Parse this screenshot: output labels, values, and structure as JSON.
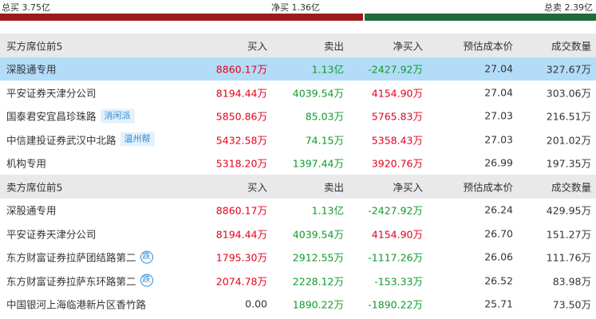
{
  "summary": {
    "buy_total": "总买 3.75亿",
    "net_buy": "净买 1.36亿",
    "sell_total": "总卖 2.39亿"
  },
  "buy_section": {
    "header": [
      "买方席位前5",
      "买入",
      "卖出",
      "净买入",
      "预估成本价",
      "成交数量"
    ],
    "rows": [
      {
        "name": "深股通专用",
        "tag": "",
        "icon": "",
        "buy": "8860.17万",
        "sell": "1.13亿",
        "net": "-2427.92万",
        "cost": "27.04",
        "vol": "327.67万",
        "buy_color": "red",
        "sell_color": "green",
        "net_color": "green"
      },
      {
        "name": "平安证券天津分公司",
        "tag": "",
        "icon": "",
        "buy": "8194.44万",
        "sell": "4039.54万",
        "net": "4154.90万",
        "cost": "27.04",
        "vol": "303.06万",
        "buy_color": "red",
        "sell_color": "green",
        "net_color": "red"
      },
      {
        "name": "国泰君安宜昌珍珠路",
        "tag": "消闲派",
        "icon": "",
        "buy": "5850.86万",
        "sell": "85.03万",
        "net": "5765.83万",
        "cost": "27.03",
        "vol": "216.51万",
        "buy_color": "red",
        "sell_color": "green",
        "net_color": "red"
      },
      {
        "name": "中信建投证券武汉中北路",
        "tag": "温州帮",
        "icon": "",
        "buy": "5432.58万",
        "sell": "74.15万",
        "net": "5358.43万",
        "cost": "27.03",
        "vol": "201.02万",
        "buy_color": "red",
        "sell_color": "green",
        "net_color": "red"
      },
      {
        "name": "机构专用",
        "tag": "",
        "icon": "",
        "buy": "5318.20万",
        "sell": "1397.44万",
        "net": "3920.76万",
        "cost": "26.99",
        "vol": "197.35万",
        "buy_color": "red",
        "sell_color": "green",
        "net_color": "red"
      }
    ]
  },
  "sell_section": {
    "header": [
      "卖方席位前5",
      "买入",
      "卖出",
      "净买入",
      "预估成本价",
      "成交数量"
    ],
    "rows": [
      {
        "name": "深股通专用",
        "tag": "",
        "icon": "",
        "buy": "8860.17万",
        "sell": "1.13亿",
        "net": "-2427.92万",
        "cost": "26.24",
        "vol": "429.95万",
        "buy_color": "red",
        "sell_color": "green",
        "net_color": "green"
      },
      {
        "name": "平安证券天津分公司",
        "tag": "",
        "icon": "",
        "buy": "8194.44万",
        "sell": "4039.54万",
        "net": "4154.90万",
        "cost": "26.70",
        "vol": "151.27万",
        "buy_color": "red",
        "sell_color": "green",
        "net_color": "red"
      },
      {
        "name": "东方财富证券拉萨团结路第二",
        "tag": "",
        "icon": "跌",
        "buy": "1795.30万",
        "sell": "2912.55万",
        "net": "-1117.26万",
        "cost": "26.06",
        "vol": "111.76万",
        "buy_color": "red",
        "sell_color": "green",
        "net_color": "green"
      },
      {
        "name": "东方财富证券拉萨东环路第二",
        "tag": "",
        "icon": "跌",
        "buy": "2074.78万",
        "sell": "2228.12万",
        "net": "-153.33万",
        "cost": "26.52",
        "vol": "83.98万",
        "buy_color": "red",
        "sell_color": "green",
        "net_color": "green"
      },
      {
        "name": "中国银河上海临港新片区香竹路",
        "tag": "",
        "icon": "",
        "buy": "0.00",
        "sell": "1890.22万",
        "net": "-1890.22万",
        "cost": "25.71",
        "vol": "73.50万",
        "buy_color": "dark",
        "sell_color": "green",
        "net_color": "green"
      }
    ]
  },
  "selected_row": "buy-0",
  "colors": {
    "up": "#e3001b",
    "down": "#0e9a2a",
    "bar_buy": "#9b1b1b",
    "bar_sell": "#1f6b3a",
    "selected": "#b3dcf9",
    "header_bg": "#e9e9e9",
    "tag": "#2b8ad8"
  }
}
